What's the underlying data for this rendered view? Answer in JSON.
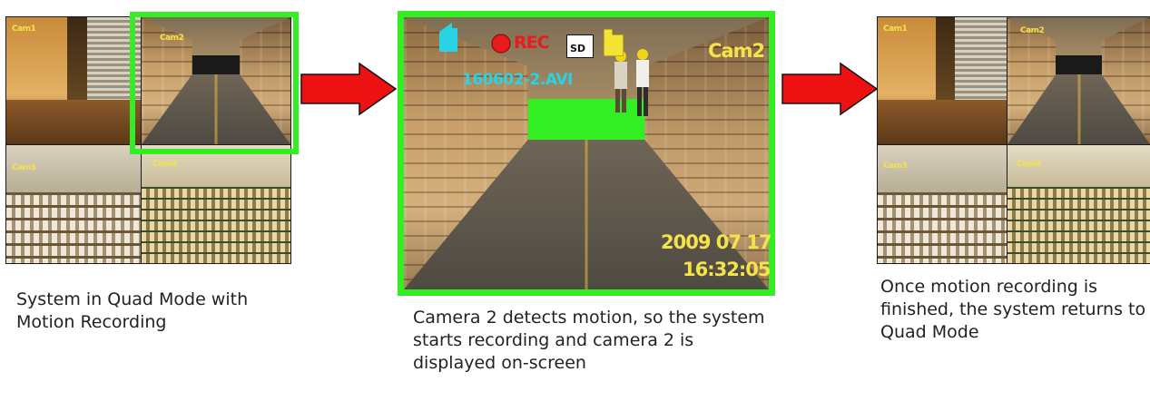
{
  "panels": {
    "quad_before": {
      "cells": [
        {
          "label": "Cam1"
        },
        {
          "label": "Cam2"
        },
        {
          "label": "Cam3"
        },
        {
          "label": "Cam4"
        }
      ],
      "caption": "System in Quad Mode with Motion Recording"
    },
    "single_recording": {
      "rec_label": "REC",
      "sd_label": "SD",
      "camera_label": "Cam2",
      "filename": "160602-2.AVI",
      "date": "2009 07 17",
      "time": "16:32:05",
      "caption": "Camera 2 detects motion, so the system starts recording and camera 2 is displayed on-screen"
    },
    "quad_after": {
      "cells": [
        {
          "label": "Cam1"
        },
        {
          "label": "Cam2"
        },
        {
          "label": "Cam3"
        },
        {
          "label": "Cam4"
        }
      ],
      "caption": "Once motion recording is finished, the system returns to Quad Mode"
    }
  },
  "colors": {
    "highlight": "#33ee22",
    "arrow": "#ee1111",
    "osd_yellow": "#f4e34a",
    "osd_cyan": "#29d3e6",
    "rec_red": "#e81c1c"
  },
  "icons": [
    "signal-icon",
    "record-dot-icon",
    "sd-card-icon",
    "folder-icon",
    "right-arrow-icon"
  ]
}
